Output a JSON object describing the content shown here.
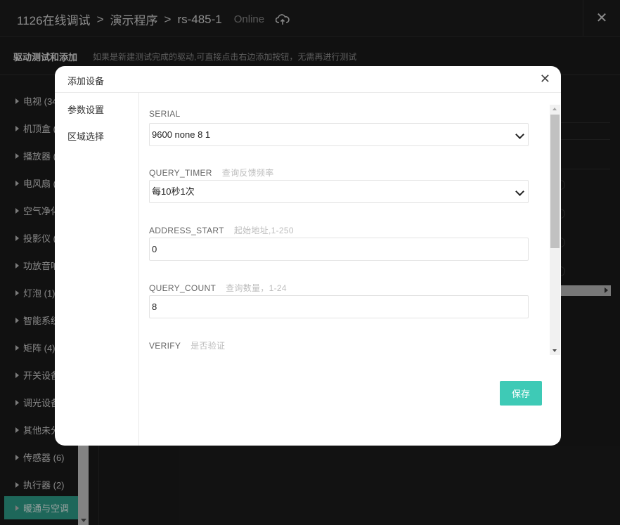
{
  "header": {
    "crumbs": [
      "1126在线调试",
      "演示程序",
      "rs-485-1"
    ],
    "status": "Online",
    "close_symbol": "✕"
  },
  "subheader": {
    "title": "驱动测试和添加",
    "hint": "如果是新建测试完成的驱动,可直接点击右边添加按钮，无需再进行测试"
  },
  "sidebar": {
    "items": [
      {
        "label": "电视 (34"
      },
      {
        "label": "机顶盒 ("
      },
      {
        "label": "播放器 ("
      },
      {
        "label": "电风扇 ("
      },
      {
        "label": "空气净化"
      },
      {
        "label": "投影仪 ("
      },
      {
        "label": "功放音响"
      },
      {
        "label": "灯泡 (1)"
      },
      {
        "label": "智能系统"
      },
      {
        "label": "矩阵 (4)"
      },
      {
        "label": "开关设备"
      },
      {
        "label": "调光设备"
      },
      {
        "label": "其他未分"
      },
      {
        "label": "传感器 (6)"
      },
      {
        "label": "执行器 (2)"
      },
      {
        "label": "暖通与空调"
      }
    ]
  },
  "modal": {
    "title": "添加设备",
    "close_symbol": "✕",
    "nav": [
      {
        "label": "参数设置"
      },
      {
        "label": "区域选择"
      }
    ],
    "fields": {
      "serial": {
        "label": "SERIAL",
        "value": "9600 none 8 1"
      },
      "query_timer": {
        "label": "QUERY_TIMER",
        "desc": "查询反馈频率",
        "value": "每10秒1次"
      },
      "address_start": {
        "label": "ADDRESS_START",
        "desc": "起始地址,1-250",
        "value": "0"
      },
      "query_count": {
        "label": "QUERY_COUNT",
        "desc": "查询数量，1-24",
        "value": "8"
      },
      "verify": {
        "label": "VERIFY",
        "desc": "是否验证"
      }
    },
    "save_label": "保存"
  },
  "colors": {
    "accent": "#3ecab6",
    "sidebar_active": "#2e9e8a",
    "background": "#1b1b1b"
  },
  "icons": {
    "cloud": "cloud-sync-icon",
    "chevron": "chevron-down-icon",
    "triangle": "caret-right-icon"
  }
}
